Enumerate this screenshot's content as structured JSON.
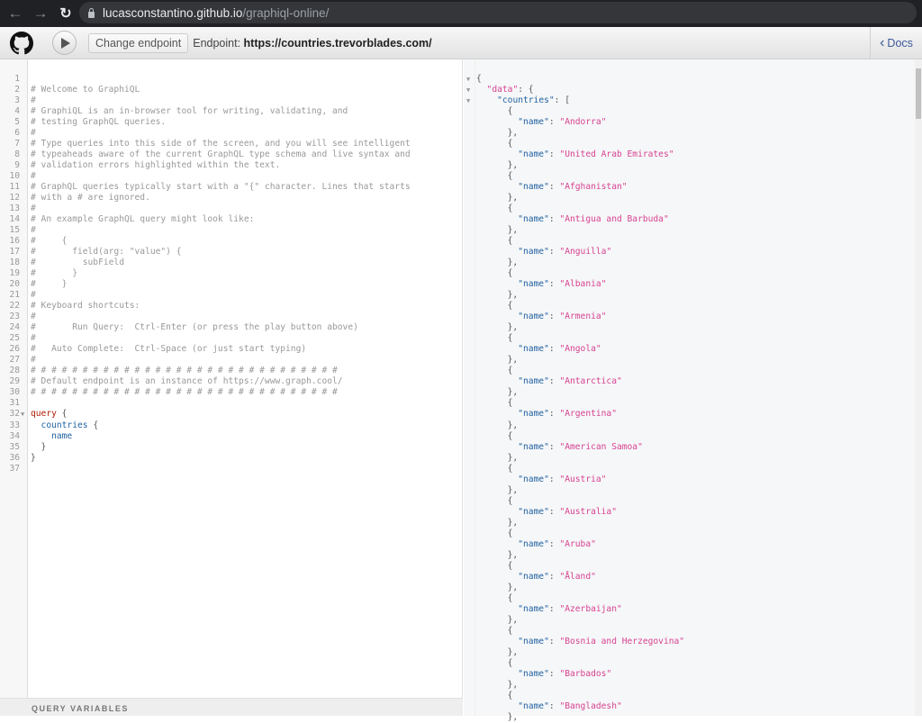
{
  "browser": {
    "url_host": "lucasconstantino.github.io",
    "url_path": "/graphiql-online/"
  },
  "toolbar": {
    "change_endpoint": "Change endpoint",
    "endpoint_label": "Endpoint:",
    "endpoint_url": "https://countries.trevorblades.com/",
    "docs": "Docs"
  },
  "editor": {
    "lines": [
      [],
      [
        {
          "t": "# Welcome to GraphiQL",
          "c": "comment"
        }
      ],
      [
        {
          "t": "#",
          "c": "comment"
        }
      ],
      [
        {
          "t": "# GraphiQL is an in-browser tool for writing, validating, and",
          "c": "comment"
        }
      ],
      [
        {
          "t": "# testing GraphQL queries.",
          "c": "comment"
        }
      ],
      [
        {
          "t": "#",
          "c": "comment"
        }
      ],
      [
        {
          "t": "# Type queries into this side of the screen, and you will see intelligent",
          "c": "comment"
        }
      ],
      [
        {
          "t": "# typeaheads aware of the current GraphQL type schema and live syntax and",
          "c": "comment"
        }
      ],
      [
        {
          "t": "# validation errors highlighted within the text.",
          "c": "comment"
        }
      ],
      [
        {
          "t": "#",
          "c": "comment"
        }
      ],
      [
        {
          "t": "# GraphQL queries typically start with a \"{\" character. Lines that starts",
          "c": "comment"
        }
      ],
      [
        {
          "t": "# with a # are ignored.",
          "c": "comment"
        }
      ],
      [
        {
          "t": "#",
          "c": "comment"
        }
      ],
      [
        {
          "t": "# An example GraphQL query might look like:",
          "c": "comment"
        }
      ],
      [
        {
          "t": "#",
          "c": "comment"
        }
      ],
      [
        {
          "t": "#     {",
          "c": "comment"
        }
      ],
      [
        {
          "t": "#       field(arg: \"value\") {",
          "c": "comment"
        }
      ],
      [
        {
          "t": "#         subField",
          "c": "comment"
        }
      ],
      [
        {
          "t": "#       }",
          "c": "comment"
        }
      ],
      [
        {
          "t": "#     }",
          "c": "comment"
        }
      ],
      [
        {
          "t": "#",
          "c": "comment"
        }
      ],
      [
        {
          "t": "# Keyboard shortcuts:",
          "c": "comment"
        }
      ],
      [
        {
          "t": "#",
          "c": "comment"
        }
      ],
      [
        {
          "t": "#       Run Query:  Ctrl-Enter (or press the play button above)",
          "c": "comment"
        }
      ],
      [
        {
          "t": "#",
          "c": "comment"
        }
      ],
      [
        {
          "t": "#   Auto Complete:  Ctrl-Space (or just start typing)",
          "c": "comment"
        }
      ],
      [
        {
          "t": "#",
          "c": "comment"
        }
      ],
      [
        {
          "t": "# # # # # # # # # # # # # # # # # # # # # # # # # # # # # #",
          "c": "comment"
        }
      ],
      [
        {
          "t": "# Default endpoint is an instance of https://www.graph.cool/",
          "c": "comment"
        }
      ],
      [
        {
          "t": "# # # # # # # # # # # # # # # # # # # # # # # # # # # # # #",
          "c": "comment"
        }
      ],
      [],
      [
        {
          "t": "query",
          "c": "kw"
        },
        {
          "t": " {",
          "c": "punct"
        }
      ],
      [
        {
          "t": "  countries",
          "c": "prop"
        },
        {
          "t": " {",
          "c": "punct"
        }
      ],
      [
        {
          "t": "    name",
          "c": "prop"
        }
      ],
      [
        {
          "t": "  }",
          "c": "punct"
        }
      ],
      [
        {
          "t": "}",
          "c": "punct"
        }
      ],
      []
    ]
  },
  "query_variables": "QUERY VARIABLES",
  "result": {
    "root_key": "data",
    "list_key": "countries",
    "field": "name",
    "countries": [
      "Andorra",
      "United Arab Emirates",
      "Afghanistan",
      "Antigua and Barbuda",
      "Anguilla",
      "Albania",
      "Armenia",
      "Angola",
      "Antarctica",
      "Argentina",
      "American Samoa",
      "Austria",
      "Australia",
      "Aruba",
      "Åland",
      "Azerbaijan",
      "Bosnia and Herzegovina",
      "Barbados",
      "Bangladesh"
    ]
  }
}
